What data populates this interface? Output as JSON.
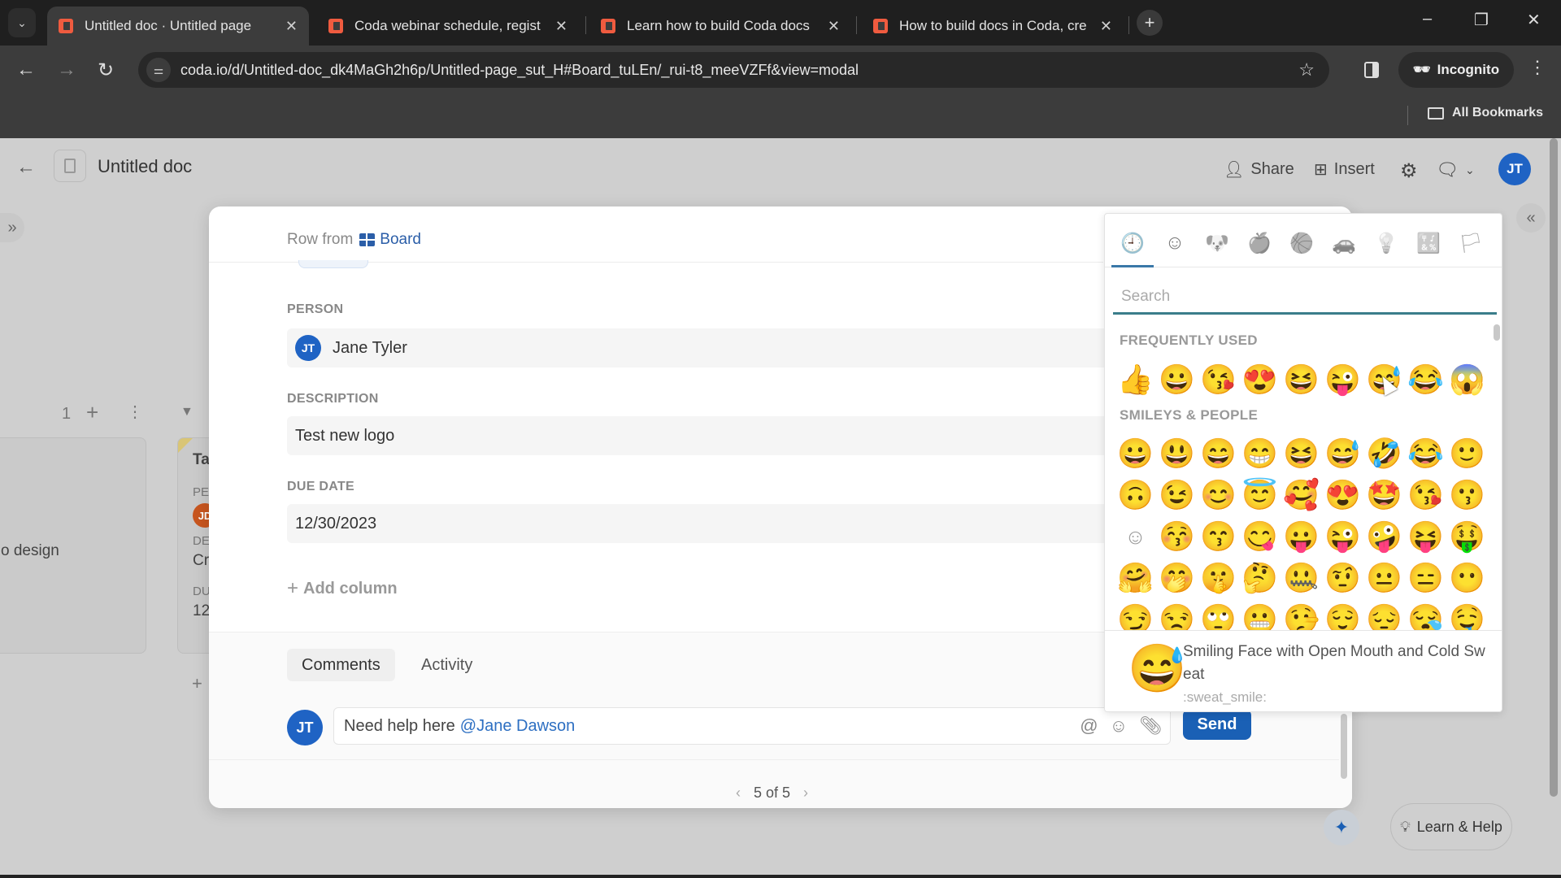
{
  "browser": {
    "tabs": [
      {
        "title": "Untitled doc · Untitled page",
        "active": true
      },
      {
        "title": "Coda webinar schedule, regist",
        "active": false
      },
      {
        "title": "Learn how to build Coda docs",
        "active": false
      },
      {
        "title": "How to build docs in Coda, cre",
        "active": false
      }
    ],
    "url": "coda.io/d/Untitled-doc_dk4MaGh2h6p/Untitled-page_sut_H#Board_tuLEn/_rui-t8_meeVZFf&view=modal",
    "incognito_label": "Incognito",
    "bookmarks_label": "All Bookmarks"
  },
  "doc": {
    "title": "Untitled doc",
    "share_label": "Share",
    "insert_label": "Insert",
    "user_initials": "JT"
  },
  "board": {
    "group_count": "1",
    "card1_text": "o design",
    "card2": {
      "title": "Ta",
      "person_label": "PE",
      "person_initials": "JD",
      "desc_label": "DE",
      "desc_value": "Cr",
      "due_label": "DU",
      "due_value": "12"
    }
  },
  "modal": {
    "row_from_label": "Row from",
    "table_name": "Board",
    "fields": {
      "person_label": "PERSON",
      "person_initials": "JT",
      "person_name": "Jane Tyler",
      "description_label": "DESCRIPTION",
      "description_value": "Test new logo",
      "due_date_label": "DUE DATE",
      "due_date_value": "12/30/2023"
    },
    "add_column_label": "Add column",
    "comment_tabs": [
      "Comments",
      "Activity"
    ],
    "comment": {
      "user_initials": "JT",
      "text": "Need help here",
      "mention": "@Jane Dawson",
      "send_label": "Send"
    },
    "pager": "5 of 5"
  },
  "emoji_picker": {
    "categories": [
      {
        "name": "recent",
        "glyph": "🕘"
      },
      {
        "name": "smileys",
        "glyph": "☺"
      },
      {
        "name": "animals",
        "glyph": "🐶"
      },
      {
        "name": "food",
        "glyph": "🍎"
      },
      {
        "name": "activity",
        "glyph": "🏀"
      },
      {
        "name": "travel",
        "glyph": "🚗"
      },
      {
        "name": "objects",
        "glyph": "💡"
      },
      {
        "name": "symbols",
        "glyph": "🔣"
      },
      {
        "name": "flags",
        "glyph": "🏳"
      }
    ],
    "search_placeholder": "Search",
    "frequently_used_title": "FREQUENTLY USED",
    "frequently_used": [
      "👍",
      "😀",
      "😘",
      "😍",
      "😆",
      "😜",
      "😅",
      "😂",
      "😱"
    ],
    "smileys_title": "SMILEYS & PEOPLE",
    "smileys_rows": [
      [
        "😀",
        "😃",
        "😄",
        "😁",
        "😆",
        "😅",
        "🤣",
        "😂",
        "🙂"
      ],
      [
        "🙃",
        "😉",
        "😊",
        "😇",
        "🥰",
        "😍",
        "🤩",
        "😘",
        "😗"
      ],
      [
        "☺",
        "😚",
        "😙",
        "😋",
        "😛",
        "😜",
        "🤪",
        "😝",
        "🤑"
      ],
      [
        "🤗",
        "🤭",
        "🤫",
        "🤔",
        "🤐",
        "🤨",
        "😐",
        "😑",
        "😶"
      ],
      [
        "😏",
        "😒",
        "🙄",
        "😬",
        "🤥",
        "😌",
        "😔",
        "😪",
        "🤤"
      ]
    ],
    "preview": {
      "emoji": "😅",
      "name": "Smiling Face with Open Mouth and Cold Sweat",
      "shortcode": ":sweat_smile:"
    }
  },
  "footer": {
    "learn_help_label": "Learn & Help"
  }
}
